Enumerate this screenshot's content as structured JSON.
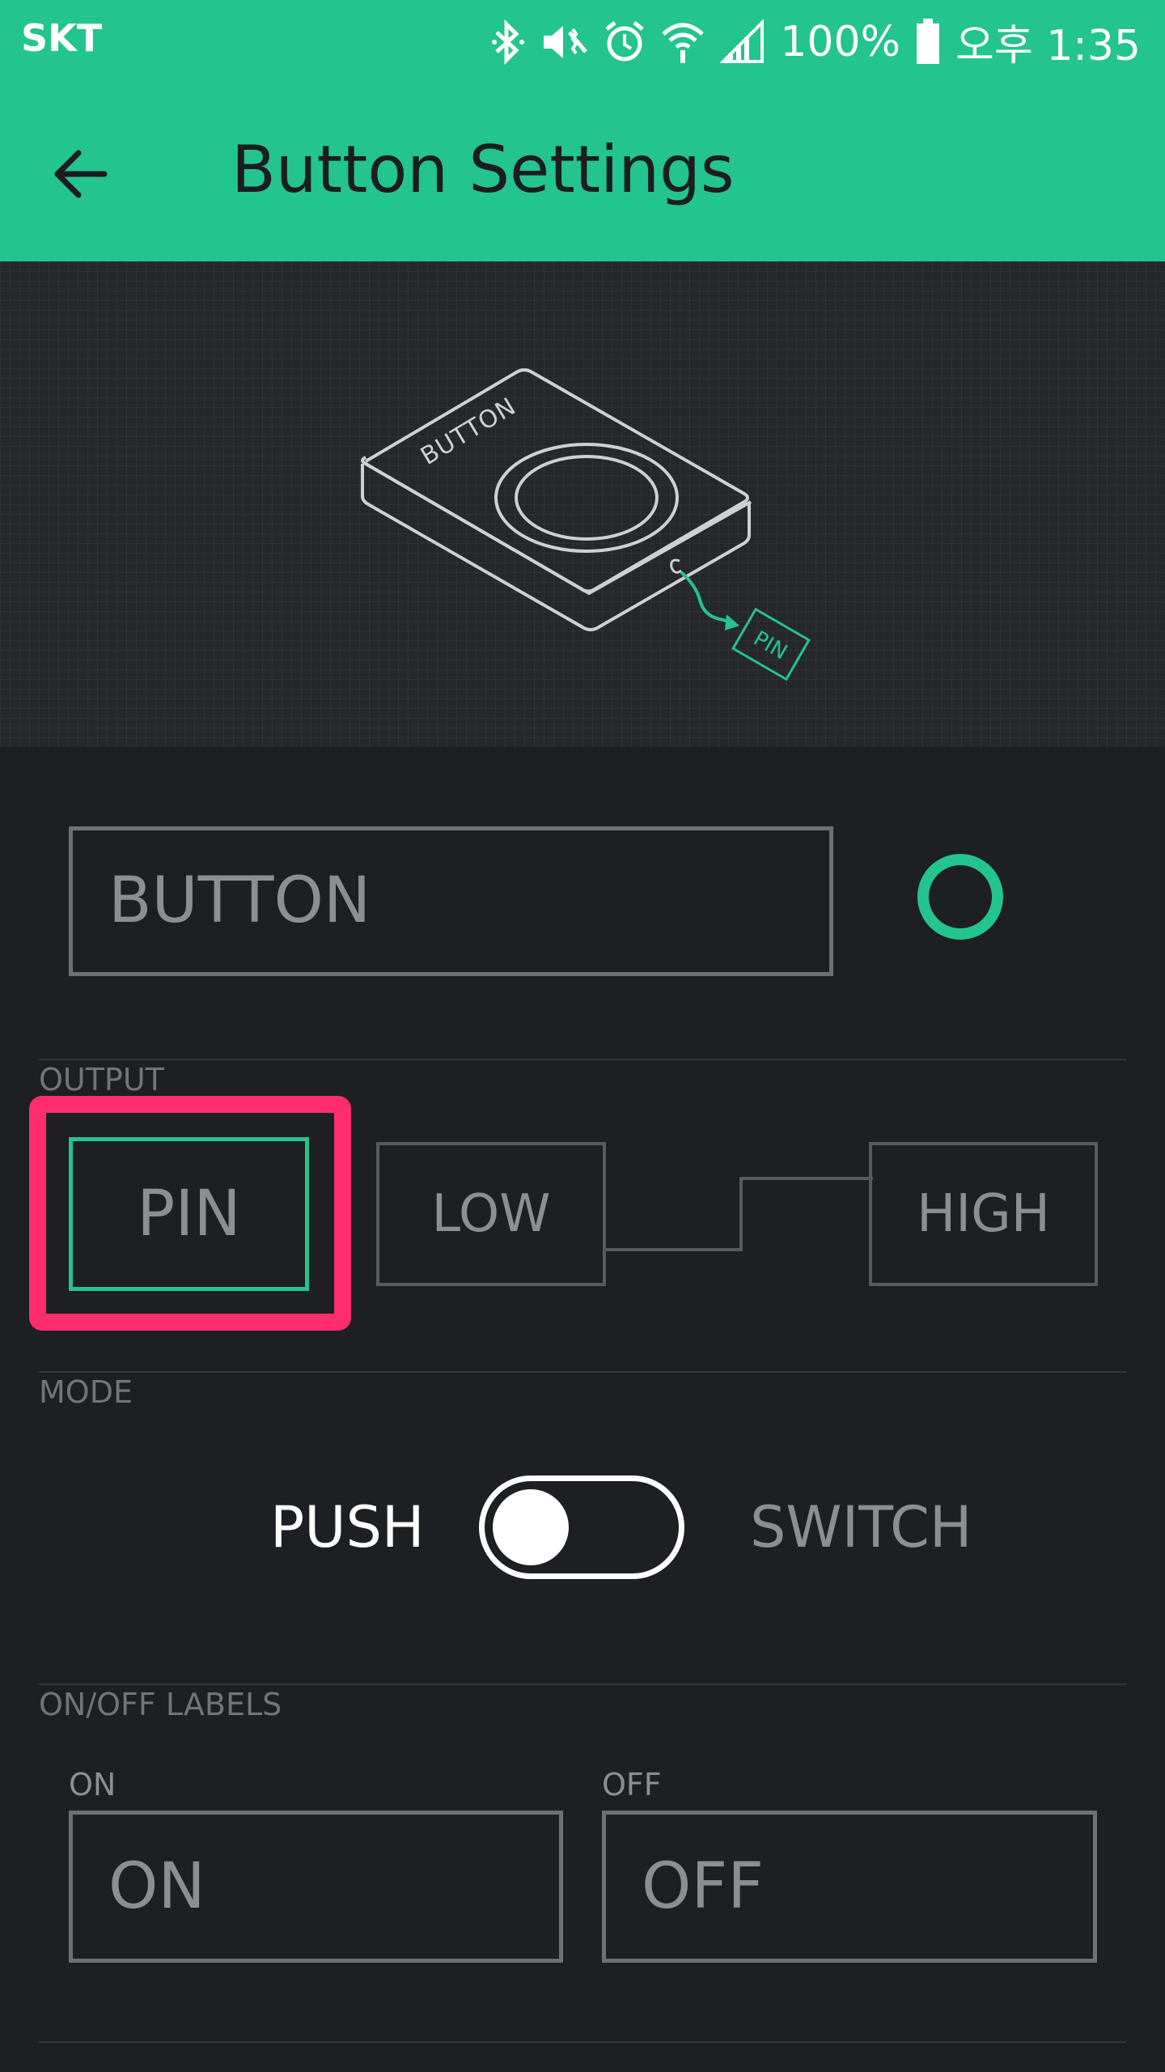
{
  "status_bar": {
    "carrier": "SKT",
    "battery": "100%",
    "time": "오후 1:35"
  },
  "app_bar": {
    "title": "Button Settings"
  },
  "preview": {
    "device_label": "BUTTON",
    "pin_label": "PIN"
  },
  "widget": {
    "name_value": "BUTTON",
    "accent_color": "#23c48e"
  },
  "output": {
    "section_label": "OUTPUT",
    "pin_label": "PIN",
    "low_label": "LOW",
    "high_label": "HIGH"
  },
  "mode": {
    "section_label": "MODE",
    "push_label": "PUSH",
    "switch_label": "SWITCH",
    "selected": "PUSH"
  },
  "labels": {
    "section_label": "ON/OFF LABELS",
    "on_caption": "ON",
    "on_value": "ON",
    "off_caption": "OFF",
    "off_value": "OFF"
  },
  "colors": {
    "brand": "#23c48e",
    "highlight": "#ff2d6f",
    "background": "#1e1f22"
  }
}
